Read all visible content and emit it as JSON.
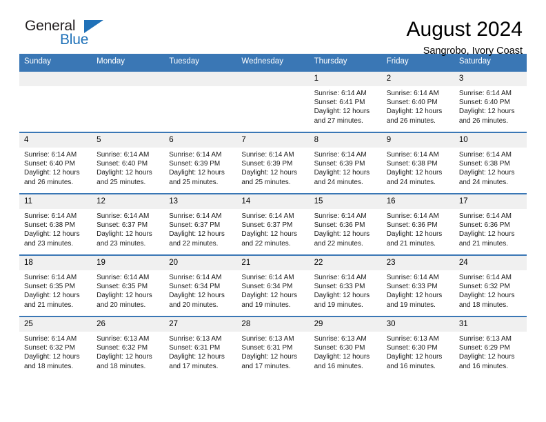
{
  "brand": {
    "name_part1": "General",
    "name_part2": "Blue",
    "accent_color": "#1f71b8"
  },
  "header": {
    "month_title": "August 2024",
    "location": "Sangrobo, Ivory Coast"
  },
  "calendar": {
    "header_color": "#3a77b5",
    "daynum_band_color": "#f0f0f0",
    "weekday_headers": [
      "Sunday",
      "Monday",
      "Tuesday",
      "Wednesday",
      "Thursday",
      "Friday",
      "Saturday"
    ],
    "weeks": [
      [
        {
          "day": "",
          "empty": true
        },
        {
          "day": "",
          "empty": true
        },
        {
          "day": "",
          "empty": true
        },
        {
          "day": "",
          "empty": true
        },
        {
          "day": "1",
          "sunrise": "Sunrise: 6:14 AM",
          "sunset": "Sunset: 6:41 PM",
          "daylight": "Daylight: 12 hours and 27 minutes."
        },
        {
          "day": "2",
          "sunrise": "Sunrise: 6:14 AM",
          "sunset": "Sunset: 6:40 PM",
          "daylight": "Daylight: 12 hours and 26 minutes."
        },
        {
          "day": "3",
          "sunrise": "Sunrise: 6:14 AM",
          "sunset": "Sunset: 6:40 PM",
          "daylight": "Daylight: 12 hours and 26 minutes."
        }
      ],
      [
        {
          "day": "4",
          "sunrise": "Sunrise: 6:14 AM",
          "sunset": "Sunset: 6:40 PM",
          "daylight": "Daylight: 12 hours and 26 minutes."
        },
        {
          "day": "5",
          "sunrise": "Sunrise: 6:14 AM",
          "sunset": "Sunset: 6:40 PM",
          "daylight": "Daylight: 12 hours and 25 minutes."
        },
        {
          "day": "6",
          "sunrise": "Sunrise: 6:14 AM",
          "sunset": "Sunset: 6:39 PM",
          "daylight": "Daylight: 12 hours and 25 minutes."
        },
        {
          "day": "7",
          "sunrise": "Sunrise: 6:14 AM",
          "sunset": "Sunset: 6:39 PM",
          "daylight": "Daylight: 12 hours and 25 minutes."
        },
        {
          "day": "8",
          "sunrise": "Sunrise: 6:14 AM",
          "sunset": "Sunset: 6:39 PM",
          "daylight": "Daylight: 12 hours and 24 minutes."
        },
        {
          "day": "9",
          "sunrise": "Sunrise: 6:14 AM",
          "sunset": "Sunset: 6:38 PM",
          "daylight": "Daylight: 12 hours and 24 minutes."
        },
        {
          "day": "10",
          "sunrise": "Sunrise: 6:14 AM",
          "sunset": "Sunset: 6:38 PM",
          "daylight": "Daylight: 12 hours and 24 minutes."
        }
      ],
      [
        {
          "day": "11",
          "sunrise": "Sunrise: 6:14 AM",
          "sunset": "Sunset: 6:38 PM",
          "daylight": "Daylight: 12 hours and 23 minutes."
        },
        {
          "day": "12",
          "sunrise": "Sunrise: 6:14 AM",
          "sunset": "Sunset: 6:37 PM",
          "daylight": "Daylight: 12 hours and 23 minutes."
        },
        {
          "day": "13",
          "sunrise": "Sunrise: 6:14 AM",
          "sunset": "Sunset: 6:37 PM",
          "daylight": "Daylight: 12 hours and 22 minutes."
        },
        {
          "day": "14",
          "sunrise": "Sunrise: 6:14 AM",
          "sunset": "Sunset: 6:37 PM",
          "daylight": "Daylight: 12 hours and 22 minutes."
        },
        {
          "day": "15",
          "sunrise": "Sunrise: 6:14 AM",
          "sunset": "Sunset: 6:36 PM",
          "daylight": "Daylight: 12 hours and 22 minutes."
        },
        {
          "day": "16",
          "sunrise": "Sunrise: 6:14 AM",
          "sunset": "Sunset: 6:36 PM",
          "daylight": "Daylight: 12 hours and 21 minutes."
        },
        {
          "day": "17",
          "sunrise": "Sunrise: 6:14 AM",
          "sunset": "Sunset: 6:36 PM",
          "daylight": "Daylight: 12 hours and 21 minutes."
        }
      ],
      [
        {
          "day": "18",
          "sunrise": "Sunrise: 6:14 AM",
          "sunset": "Sunset: 6:35 PM",
          "daylight": "Daylight: 12 hours and 21 minutes."
        },
        {
          "day": "19",
          "sunrise": "Sunrise: 6:14 AM",
          "sunset": "Sunset: 6:35 PM",
          "daylight": "Daylight: 12 hours and 20 minutes."
        },
        {
          "day": "20",
          "sunrise": "Sunrise: 6:14 AM",
          "sunset": "Sunset: 6:34 PM",
          "daylight": "Daylight: 12 hours and 20 minutes."
        },
        {
          "day": "21",
          "sunrise": "Sunrise: 6:14 AM",
          "sunset": "Sunset: 6:34 PM",
          "daylight": "Daylight: 12 hours and 19 minutes."
        },
        {
          "day": "22",
          "sunrise": "Sunrise: 6:14 AM",
          "sunset": "Sunset: 6:33 PM",
          "daylight": "Daylight: 12 hours and 19 minutes."
        },
        {
          "day": "23",
          "sunrise": "Sunrise: 6:14 AM",
          "sunset": "Sunset: 6:33 PM",
          "daylight": "Daylight: 12 hours and 19 minutes."
        },
        {
          "day": "24",
          "sunrise": "Sunrise: 6:14 AM",
          "sunset": "Sunset: 6:32 PM",
          "daylight": "Daylight: 12 hours and 18 minutes."
        }
      ],
      [
        {
          "day": "25",
          "sunrise": "Sunrise: 6:14 AM",
          "sunset": "Sunset: 6:32 PM",
          "daylight": "Daylight: 12 hours and 18 minutes."
        },
        {
          "day": "26",
          "sunrise": "Sunrise: 6:13 AM",
          "sunset": "Sunset: 6:32 PM",
          "daylight": "Daylight: 12 hours and 18 minutes."
        },
        {
          "day": "27",
          "sunrise": "Sunrise: 6:13 AM",
          "sunset": "Sunset: 6:31 PM",
          "daylight": "Daylight: 12 hours and 17 minutes."
        },
        {
          "day": "28",
          "sunrise": "Sunrise: 6:13 AM",
          "sunset": "Sunset: 6:31 PM",
          "daylight": "Daylight: 12 hours and 17 minutes."
        },
        {
          "day": "29",
          "sunrise": "Sunrise: 6:13 AM",
          "sunset": "Sunset: 6:30 PM",
          "daylight": "Daylight: 12 hours and 16 minutes."
        },
        {
          "day": "30",
          "sunrise": "Sunrise: 6:13 AM",
          "sunset": "Sunset: 6:30 PM",
          "daylight": "Daylight: 12 hours and 16 minutes."
        },
        {
          "day": "31",
          "sunrise": "Sunrise: 6:13 AM",
          "sunset": "Sunset: 6:29 PM",
          "daylight": "Daylight: 12 hours and 16 minutes."
        }
      ]
    ]
  }
}
